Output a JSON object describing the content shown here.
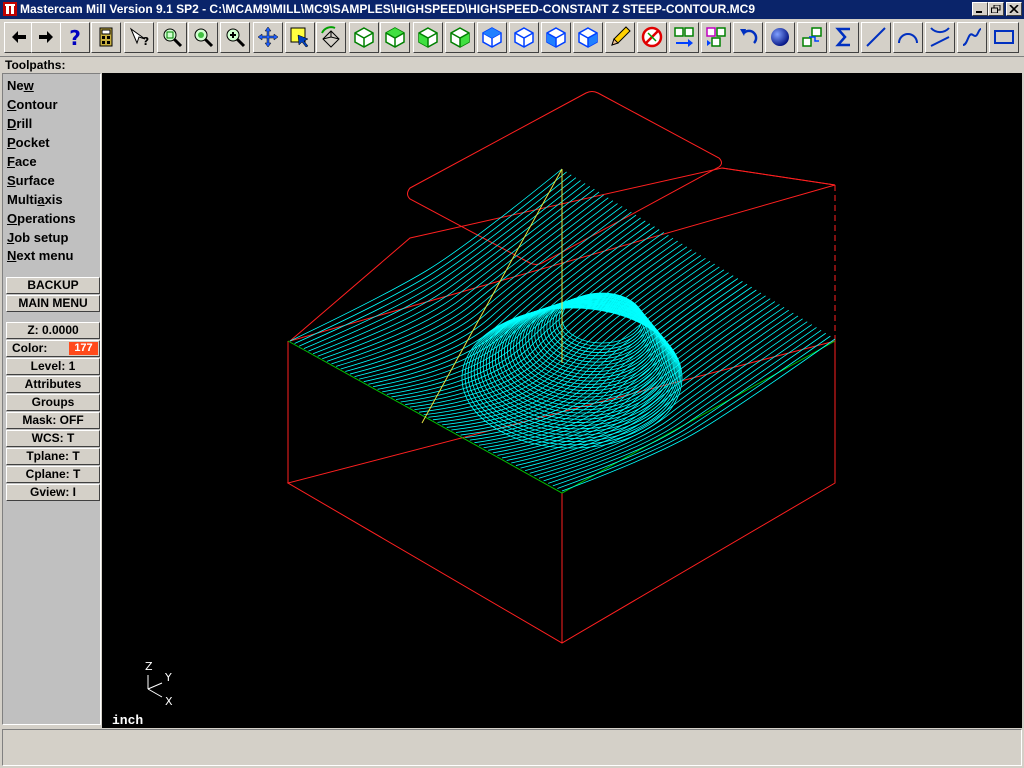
{
  "window": {
    "title": "Mastercam Mill Version 9.1 SP2 - C:\\MCAM9\\MILL\\MC9\\SAMPLES\\HIGHSPEED\\HIGHSPEED-CONSTANT Z STEEP-CONTOUR.MC9"
  },
  "toolbar": {
    "icons": [
      "back-arrow-icon",
      "forward-arrow-icon",
      "help-icon",
      "calculator-icon",
      "analyze-icon",
      "zoom-window-icon",
      "zoom-fit-icon",
      "zoom-in-icon",
      "pan-icon",
      "select-icon",
      "rotate-icon",
      "cube-iso-icon",
      "cube-top-icon",
      "cube-front-icon",
      "cube-side-icon",
      "cube-blue-iso-icon",
      "cube-blue-top-icon",
      "cube-blue-front-icon",
      "cube-blue-side-icon",
      "pencil-icon",
      "no-entity-icon",
      "move-icon",
      "copy-icon",
      "undo-icon",
      "sphere-icon",
      "transform-icon",
      "sigma-icon",
      "line-icon",
      "arc-icon",
      "trim-icon",
      "spline-icon",
      "rectangle-icon"
    ]
  },
  "menu": {
    "header": "Toolpaths:",
    "items": [
      {
        "pre": "Ne",
        "key": "w",
        "post": ""
      },
      {
        "pre": "",
        "key": "C",
        "post": "ontour"
      },
      {
        "pre": "",
        "key": "D",
        "post": "rill"
      },
      {
        "pre": "",
        "key": "P",
        "post": "ocket"
      },
      {
        "pre": "",
        "key": "F",
        "post": "ace"
      },
      {
        "pre": "",
        "key": "S",
        "post": "urface"
      },
      {
        "pre": "Multi",
        "key": "a",
        "post": "xis"
      },
      {
        "pre": "",
        "key": "O",
        "post": "perations"
      },
      {
        "pre": "",
        "key": "J",
        "post": "ob setup"
      },
      {
        "pre": "",
        "key": "N",
        "post": "ext menu"
      }
    ],
    "backup": "BACKUP",
    "main_menu": "MAIN MENU"
  },
  "params": {
    "z": "Z:  0.0000",
    "color_label": "Color:",
    "color_value": "177",
    "level": "Level:  1",
    "attributes": "Attributes",
    "groups": "Groups",
    "mask": "Mask:  OFF",
    "wcs": "WCS:   T",
    "tplane": "Tplane:  T",
    "cplane": "Cplane:  T",
    "gview": "Gview:   I"
  },
  "viewport": {
    "units": "inch",
    "axis_z": "Z",
    "axis_y": "Y",
    "axis_x": "X"
  },
  "colors": {
    "toolpath": "#00ffff",
    "boundary": "#ff2020",
    "tool_axis": "#ffff40",
    "accent": "#ff4a1c"
  }
}
